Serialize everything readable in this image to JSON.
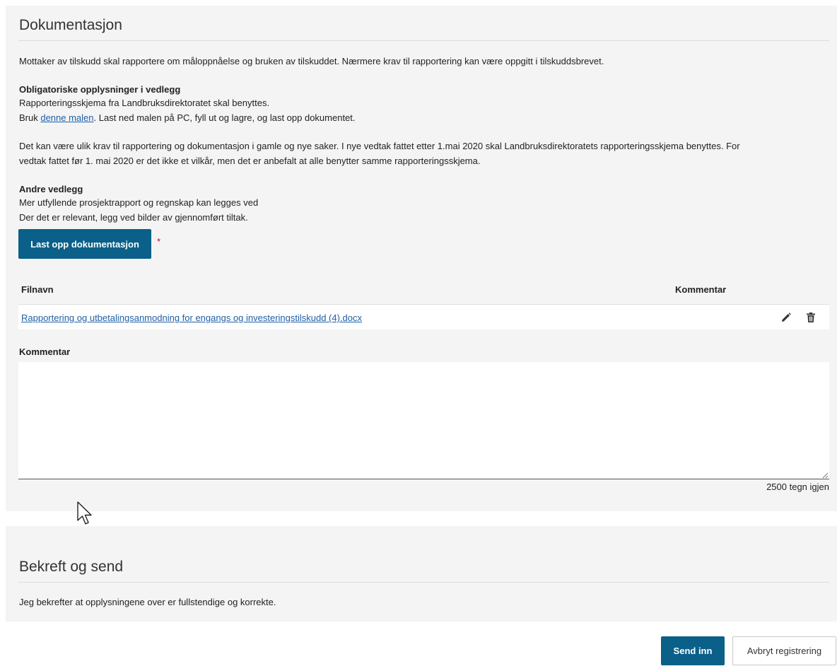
{
  "documentation": {
    "title": "Dokumentasjon",
    "intro": "Mottaker av tilskudd skal rapportere om måloppnåelse og bruken av tilskuddet. Nærmere krav til rapportering kan være oppgitt i tilskuddsbrevet.",
    "mandatory_heading": "Obligatoriske opplysninger i vedlegg",
    "mandatory_line1": "Rapporteringsskjema fra Landbruksdirektoratet skal benyttes.",
    "mandatory_line2_prefix": "Bruk ",
    "mandatory_link": "denne malen",
    "mandatory_line2_suffix": ". Last ned malen på PC, fyll ut og lagre, og last opp dokumentet.",
    "rules_line1": "Det kan være ulik krav til rapportering og dokumentasjon i gamle og nye saker. I nye vedtak fattet etter 1.mai 2020 skal Landbruksdirektoratets rapporteringsskjema benyttes. For",
    "rules_line2": "vedtak fattet før 1. mai 2020 er det ikke et vilkår, men det er anbefalt at alle benytter samme rapporteringsskjema.",
    "other_heading": "Andre vedlegg",
    "other_line1": "Mer utfyllende prosjektrapport og regnskap kan legges ved",
    "other_line2": "Der det er relevant, legg ved bilder av gjennomført tiltak.",
    "upload_label": "Last opp dokumentasjon",
    "required_mark": "*",
    "files_table": {
      "columns": [
        "Filnavn",
        "Kommentar"
      ],
      "rows": [
        {
          "filename": "Rapportering og utbetalingsanmodning for engangs og investeringstilskudd (4).docx",
          "comment": ""
        }
      ]
    },
    "comment_label": "Kommentar",
    "comment_value": "",
    "counter_text": "2500 tegn igjen"
  },
  "confirm": {
    "title": "Bekreft og send",
    "statement": "Jeg bekrefter at opplysningene over er fullstendige og korrekte."
  },
  "actions": {
    "submit_label": "Send inn",
    "cancel_label": "Avbryt registrering"
  },
  "icons": {
    "edit": "pencil-icon",
    "delete": "trash-icon",
    "cursor": "mouse-pointer-icon"
  },
  "colors": {
    "primary": "#0a6089",
    "link": "#1f5fa6",
    "required": "#d0021b",
    "panel_bg": "#f4f4f4"
  }
}
